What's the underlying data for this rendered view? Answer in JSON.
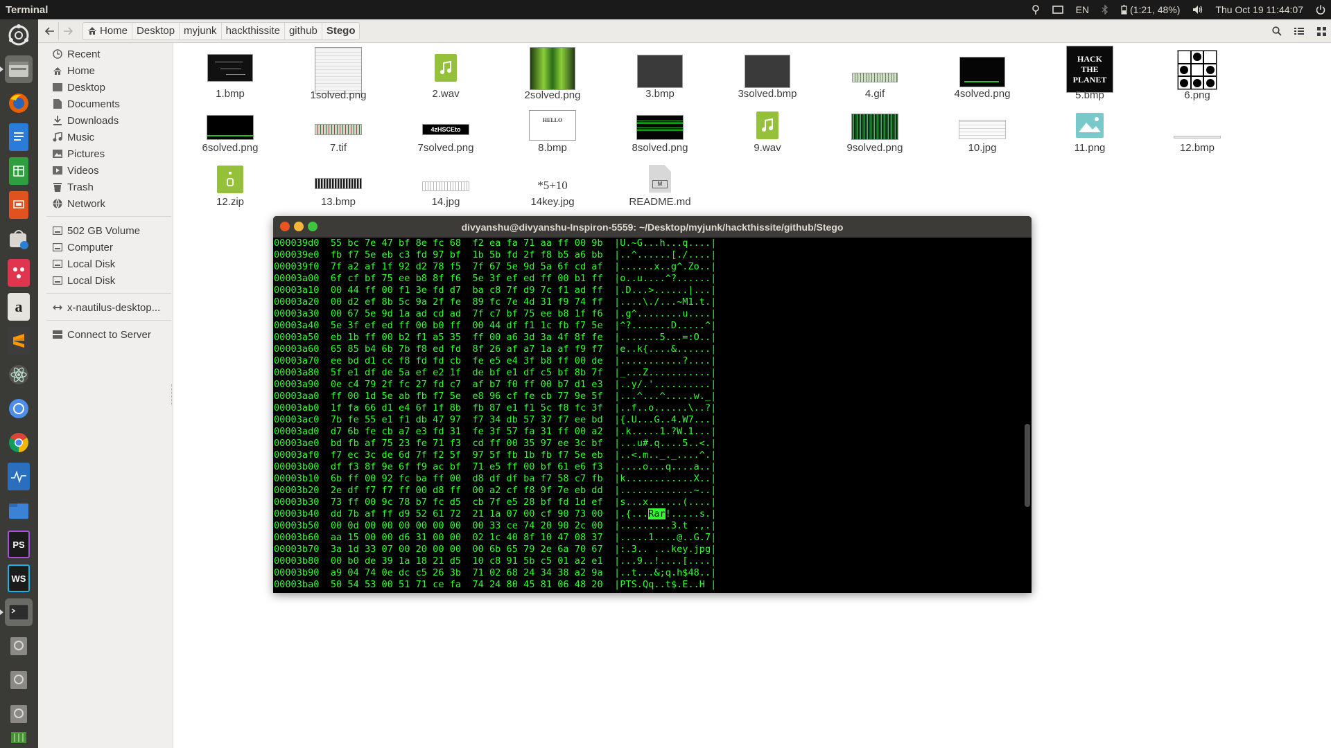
{
  "panel": {
    "app_title": "Terminal",
    "lang": "EN",
    "battery": "(1:21, 48%)",
    "datetime": "Thu Oct 19 11:44:07"
  },
  "launcher": [
    {
      "name": "dash-icon"
    },
    {
      "name": "files-icon"
    },
    {
      "name": "firefox-icon"
    },
    {
      "name": "writer-icon"
    },
    {
      "name": "calc-icon"
    },
    {
      "name": "impress-icon"
    },
    {
      "name": "software-center-icon"
    },
    {
      "name": "app-icon"
    },
    {
      "name": "amazon-icon"
    },
    {
      "name": "sublime-text-icon"
    },
    {
      "name": "atom-icon"
    },
    {
      "name": "chromium-icon"
    },
    {
      "name": "chrome-icon"
    },
    {
      "name": "system-monitor-icon"
    },
    {
      "name": "folder-icon"
    },
    {
      "name": "phpstorm-icon"
    },
    {
      "name": "webstorm-icon"
    },
    {
      "name": "terminal-icon"
    },
    {
      "name": "disk-icon-1"
    },
    {
      "name": "disk-icon-2"
    },
    {
      "name": "disk-icon-3"
    },
    {
      "name": "trash-icon"
    }
  ],
  "breadcrumb": [
    "Home",
    "Desktop",
    "myjunk",
    "hackthissite",
    "github",
    "Stego"
  ],
  "sidebar": {
    "places": [
      "Recent",
      "Home",
      "Desktop",
      "Documents",
      "Downloads",
      "Music",
      "Pictures",
      "Videos",
      "Trash",
      "Network"
    ],
    "devices": [
      "502 GB Volume",
      "Computer",
      "Local Disk",
      "Local Disk"
    ],
    "other": "x-nautilus-desktop...",
    "connect": "Connect to Server"
  },
  "files": [
    {
      "label": "1.bmp",
      "icon": "bmp-thumb"
    },
    {
      "label": "1solved.png",
      "icon": "png-thumb"
    },
    {
      "label": "2.wav",
      "icon": "audio-icon"
    },
    {
      "label": "2solved.png",
      "icon": "png-thumb"
    },
    {
      "label": "3.bmp",
      "icon": "bmp-thumb"
    },
    {
      "label": "3solved.bmp",
      "icon": "bmp-thumb"
    },
    {
      "label": "4.gif",
      "icon": "gif-thumb"
    },
    {
      "label": "4solved.png",
      "icon": "png-thumb"
    },
    {
      "label": "5.bmp",
      "icon": "bmp-thumb",
      "thumb_text": "HACK THE PLANET"
    },
    {
      "label": "6.png",
      "icon": "png-thumb"
    },
    {
      "label": "6solved.png",
      "icon": "png-thumb"
    },
    {
      "label": "7.tif",
      "icon": "tif-thumb"
    },
    {
      "label": "7solved.png",
      "icon": "png-thumb",
      "thumb_text": "4zHSCEto"
    },
    {
      "label": "8.bmp",
      "icon": "bmp-thumb",
      "thumb_text": "HELLO"
    },
    {
      "label": "8solved.png",
      "icon": "png-thumb"
    },
    {
      "label": "9.wav",
      "icon": "audio-icon"
    },
    {
      "label": "9solved.png",
      "icon": "png-thumb"
    },
    {
      "label": "10.jpg",
      "icon": "jpg-thumb"
    },
    {
      "label": "11.png",
      "icon": "image-icon"
    },
    {
      "label": "12.bmp",
      "icon": "bmp-thumb"
    },
    {
      "label": "12.zip",
      "icon": "archive-icon"
    },
    {
      "label": "13.bmp",
      "icon": "bmp-thumb"
    },
    {
      "label": "14.jpg",
      "icon": "jpg-thumb"
    },
    {
      "label": "14key.jpg",
      "icon": "jpg-thumb",
      "thumb_text": "*5+10"
    },
    {
      "label": "README.md",
      "icon": "markdown-icon"
    }
  ],
  "terminal": {
    "title": "divyanshu@divyanshu-Inspiron-5559: ~/Desktop/myjunk/hackthissite/github/Stego",
    "highlight": "Rar",
    "lines": [
      "000039d0  55 bc 7e 47 bf 8e fc 68  f2 ea fa 71 aa ff 00 9b  |U.~G...h...q....|",
      "000039e0  fb f7 5e eb c3 fd 97 bf  1b 5b fd 2f f8 b5 a6 bb  |..^......[./....|",
      "000039f0  7f a2 af 1f 92 d2 78 f5  7f 67 5e 9d 5a 6f cd af  |......x..g^.Zo..|",
      "00003a00  6f cf bf 75 ee b8 8f f6  5e 3f ef ed ff 00 b1 ff  |o..u....^?......|",
      "00003a10  00 44 ff 00 f1 3e fd d7  ba c8 7f d9 7c f1 ad ff  |.D...>......|...|",
      "00003a20  00 d2 ef 8b 5c 9a 2f fe  89 fc 7e 4d 31 f9 74 ff  |....\\./...~M1.t.|",
      "00003a30  00 67 5e 9d 1a ad cd ad  7f c7 bf 75 ee b8 1f f6  |.g^........u....|",
      "00003a40  5e 3f ef ed ff 00 b0 ff  00 44 df f1 1c fb f7 5e  |^?.......D.....^|",
      "00003a50  eb 1b ff 00 b2 f1 a5 35  ff 00 a6 3d 3a 4f 8f fe  |.......5...=:O..|",
      "00003a60  65 85 b4 6b 7b f8 ed fd  8f 26 af a7 1a af f9 f7  |e..k{....&......|",
      "00003a70  ee bd d1 cc f8 fd fd cb  fe e5 e4 3f b8 ff 00 de  |...........?....|",
      "00003a80  5f e1 df de 5a ef e2 1f  de bf e1 df c5 bf 8b 7f  |_...Z...........|",
      "00003a90  0e c4 79 2f fc 27 fd c7  af b7 f0 ff 00 b7 d1 e3  |..y/.'..........|",
      "00003aa0  ff 00 1d 5e ab fb f7 5e  e8 96 cf fe cb 77 9e 5f  |...^...^.....w._|",
      "00003ab0  1f fa 66 d1 e4 6f 1f 8b  fb 87 e1 f1 5c f8 fc 3f  |..f..o......\\..?|",
      "00003ac0  7b fe 55 e1 f1 db 47 97  f7 34 db 57 37 f7 ee bd  |{.U...G..4.W7...|",
      "00003ad0  d7 6b fe cb a7 e3 fd 31  fe 3f 57 fa 31 ff 00 a2  |.k.....1.?W.1...|",
      "00003ae0  bd fb af 75 23 fe 71 f3  cd ff 00 35 97 ee 3c bf  |...u#.q....5..<.|",
      "00003af0  f7 ec 3c de 6d 7f f2 5f  97 5f fb 1b fb f7 5e eb  |..<.m.._._....^.|",
      "00003b00  df f3 8f 9e 6f f9 ac bf  71 e5 ff 00 bf 61 e6 f3  |....o...q....a..|",
      "00003b10  6b ff 00 92 fc ba ff 00  d8 df df ba f7 58 c7 fb  |k............X..|",
      "00003b20  2e df f7 f7 ff 00 d8 ff  00 a2 cf f8 9f 7e eb dd  |.............~..|",
      "00003b30  73 ff 00 9c 78 b7 fc d5  cb 7f e5 28 bf fd 1d ef  |s...x......(....|",
      "00003b40  dd 7b af ff d9 52 61 72  21 1a 07 00 cf 90 73 00  |.{...Rar!.....s.|",
      "00003b50  00 0d 00 00 00 00 00 00  00 33 ce 74 20 90 2c 00  |.........3.t .,.|",
      "00003b60  aa 15 00 00 d6 31 00 00  02 1c 40 8f 10 47 08 37  |.....1....@..G.7|",
      "00003b70  3a 1d 33 07 00 20 00 00  00 6b 65 79 2e 6a 70 67  |:.3.. ...key.jpg|",
      "00003b80  00 b0 de 39 1a 18 21 d5  10 c8 91 5b c5 01 a2 e1  |...9..!....[....|",
      "00003b90  a9 04 74 0e dc c5 26 3b  71 02 68 24 34 38 a2 9a  |..t...&;q.h$48..|",
      "00003ba0  50 54 53 00 51 71 ce fa  74 24 80 45 81 06 48 20  |PTS.Qq..t$.E..H |"
    ]
  },
  "colors": {
    "terminal_text": "#2fff2f",
    "terminal_bg": "#000000",
    "close": "#e95420",
    "minimize": "#f5b43a",
    "maximize": "#3fc43f"
  }
}
